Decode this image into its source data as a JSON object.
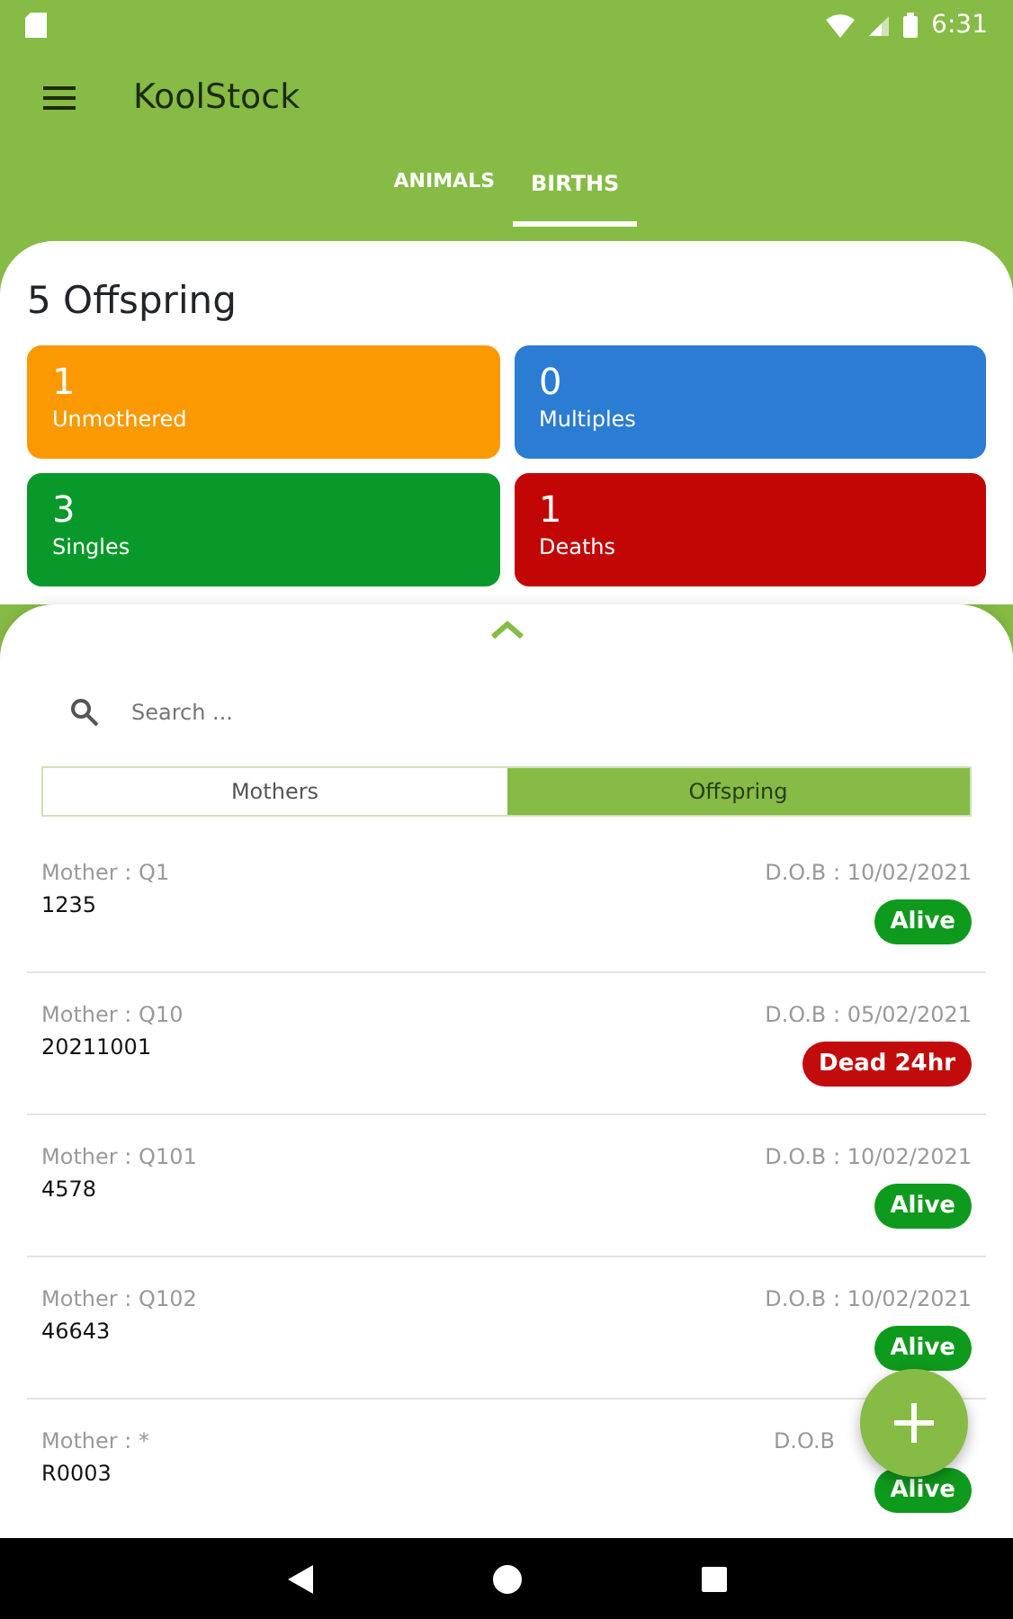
{
  "status_bar": {
    "time": "6:31"
  },
  "app_bar": {
    "title": "KoolStock"
  },
  "tabs": [
    {
      "label": "ANIMALS",
      "selected": false
    },
    {
      "label": "BIRTHS",
      "selected": true
    }
  ],
  "summary": {
    "title": "5 Offspring",
    "stats": [
      {
        "value": "1",
        "label": "Unmothered",
        "color": "#fb9900"
      },
      {
        "value": "0",
        "label": "Multiples",
        "color": "#2b7cd3"
      },
      {
        "value": "3",
        "label": "Singles",
        "color": "#09992b"
      },
      {
        "value": "1",
        "label": "Deaths",
        "color": "#c20505"
      }
    ]
  },
  "search": {
    "placeholder": "Search ..."
  },
  "segments": [
    {
      "label": "Mothers",
      "selected": false
    },
    {
      "label": "Offspring",
      "selected": true
    }
  ],
  "rows": [
    {
      "mother": "Mother : Q1",
      "id": "1235",
      "dob": "D.O.B : 10/02/2021",
      "status": "Alive",
      "color": "#0e9a1c"
    },
    {
      "mother": "Mother : Q10",
      "id": "20211001",
      "dob": "D.O.B : 05/02/2021",
      "status": "Dead 24hr",
      "color": "#c20b0b"
    },
    {
      "mother": "Mother : Q101",
      "id": "4578",
      "dob": "D.O.B : 10/02/2021",
      "status": "Alive",
      "color": "#0e9a1c"
    },
    {
      "mother": "Mother : Q102",
      "id": "46643",
      "dob": "D.O.B : 10/02/2021",
      "status": "Alive",
      "color": "#0e9a1c"
    },
    {
      "mother": "Mother :  *",
      "id": "R0003",
      "dob": "D.O.B",
      "status": "Alive",
      "color": "#0e9a1c"
    }
  ]
}
